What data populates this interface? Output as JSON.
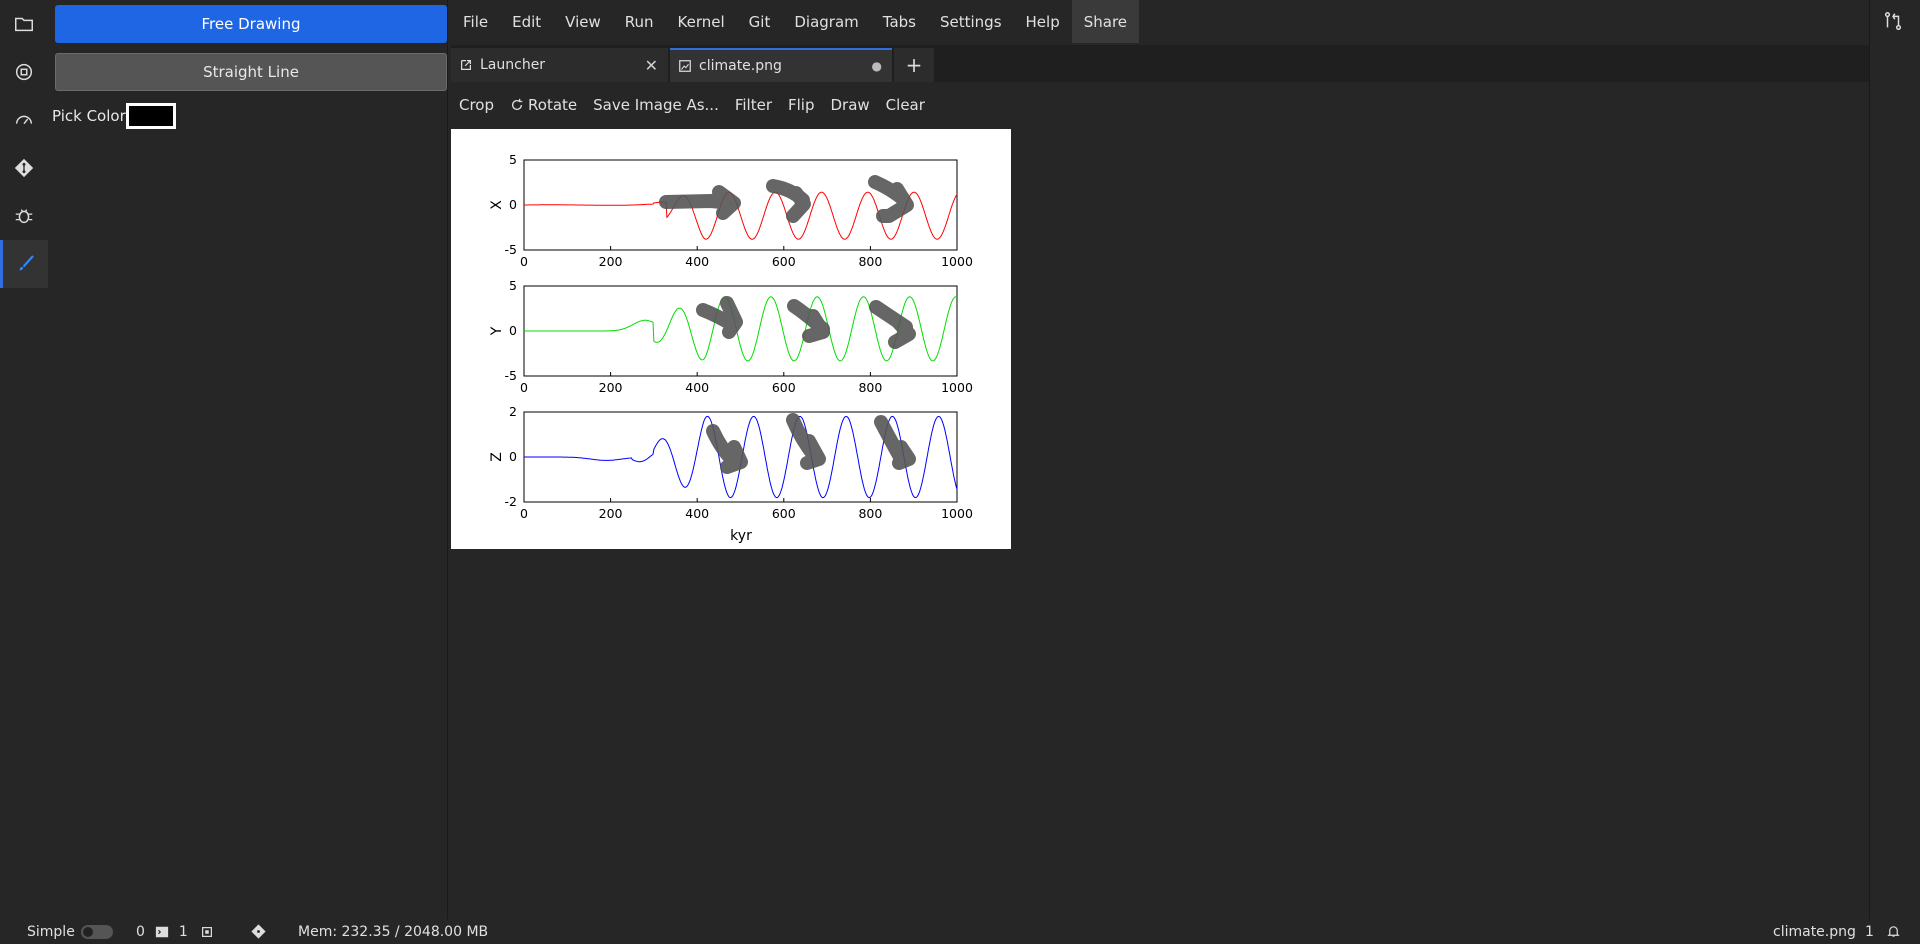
{
  "side_panel": {
    "free_drawing_label": "Free Drawing",
    "straight_line_label": "Straight Line",
    "pick_color_label": "Pick Color",
    "pick_color_value": "#000000"
  },
  "menubar": [
    "File",
    "Edit",
    "View",
    "Run",
    "Kernel",
    "Git",
    "Diagram",
    "Tabs",
    "Settings",
    "Help",
    "Share"
  ],
  "tabs": {
    "launcher": "Launcher",
    "climate": "climate.png",
    "close": "✕",
    "modified": "●",
    "add": "+"
  },
  "image_toolbar": {
    "crop": "Crop",
    "rotate": "Rotate",
    "save": "Save Image As...",
    "filter": "Filter",
    "flip": "Flip",
    "draw": "Draw",
    "clear": "Clear"
  },
  "chart_data": {
    "type": "line",
    "xlabel": "kyr",
    "xlim": [
      0,
      1000
    ],
    "x_ticks": [
      "0",
      "200",
      "400",
      "600",
      "800",
      "1000"
    ],
    "panels": [
      {
        "ylabel": "X",
        "ylim": [
          -5,
          5
        ],
        "y_ticks": [
          "5",
          "0",
          "-5"
        ],
        "color": "#ff0000"
      },
      {
        "ylabel": "Y",
        "ylim": [
          -5,
          5
        ],
        "y_ticks": [
          "5",
          "0",
          "-5"
        ],
        "color": "#00dd00"
      },
      {
        "ylabel": "Z",
        "ylim": [
          -2,
          2
        ],
        "y_ticks": [
          "2",
          "0",
          "-2"
        ],
        "color": "#0000ff"
      }
    ],
    "annotation_color": "#555555"
  },
  "status": {
    "mode": "Simple",
    "kernels": "0",
    "terminals": "1",
    "memory": "Mem: 232.35 / 2048.00 MB",
    "filename": "climate.png",
    "line": "1"
  }
}
